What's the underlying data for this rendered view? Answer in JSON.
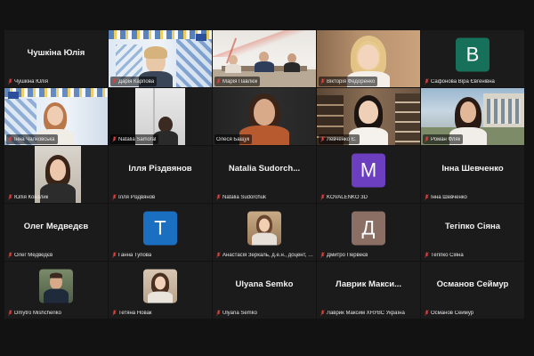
{
  "colors": {
    "background": "#121212",
    "tile": "#1b1b1b",
    "active_speaker_border": "#3cc063",
    "mic_muted": "#e0413b",
    "avatar_v": "#16705a",
    "avatar_m": "#6b3fc0",
    "avatar_t": "#1b6fc0",
    "avatar_d": "#8b6f64"
  },
  "tiles": [
    {
      "label": "Чушкіна Юлія",
      "center_name": "Чушкіна Юлія",
      "type": "name"
    },
    {
      "label": "Дарія Карпова",
      "type": "video"
    },
    {
      "label": "Марія Павлюк",
      "type": "video"
    },
    {
      "label": "Вікторія Федоренко",
      "type": "video"
    },
    {
      "label": "Сафонова Віра Євгенівна",
      "type": "letter",
      "letter": "В"
    },
    {
      "label": "Інна Чалковська",
      "type": "video"
    },
    {
      "label": "Natalia Samofal",
      "type": "video"
    },
    {
      "label": "Олеся Бащук",
      "type": "video",
      "active": true
    },
    {
      "label": "Левченко Є.",
      "type": "video"
    },
    {
      "label": "Роман Фляк",
      "type": "video"
    },
    {
      "label": "Юлія Ковалик",
      "type": "video"
    },
    {
      "label": "Ілля Різдвянов",
      "center_name": "Ілля Різдвянов",
      "type": "name"
    },
    {
      "label": "Natalia Sudorchuk",
      "center_name": "Natalia Sudorch...",
      "type": "name"
    },
    {
      "label": "KOVALENKO 3D",
      "type": "letter",
      "letter": "M"
    },
    {
      "label": "Інна Шевченко",
      "center_name": "Інна Шевченко",
      "type": "name"
    },
    {
      "label": "Олег Медведєв",
      "center_name": "Олег Медведєв",
      "type": "name"
    },
    {
      "label": "Ганна Тупова",
      "type": "letter",
      "letter": "T"
    },
    {
      "label": "Анастасія Зеркаль, д.е.н., доцент, пр...",
      "type": "photo"
    },
    {
      "label": "Дмитро Первеєв",
      "type": "letter",
      "letter": "Д"
    },
    {
      "label": "Тегіпко Сіяна",
      "center_name": "Тегіпко Сіяна",
      "type": "name"
    },
    {
      "label": "Dmytro Mishchenko",
      "type": "photo"
    },
    {
      "label": "Тетяна Новак",
      "type": "photo"
    },
    {
      "label": "Ulyana Semko",
      "center_name": "Ulyana Semko",
      "type": "name"
    },
    {
      "label": "Лаврик Максим ХНУВС Україна",
      "center_name": "Лаврик Макси...",
      "type": "name"
    },
    {
      "label": "Османов Сеймур",
      "center_name": "Османов Сеймур",
      "type": "name"
    }
  ]
}
